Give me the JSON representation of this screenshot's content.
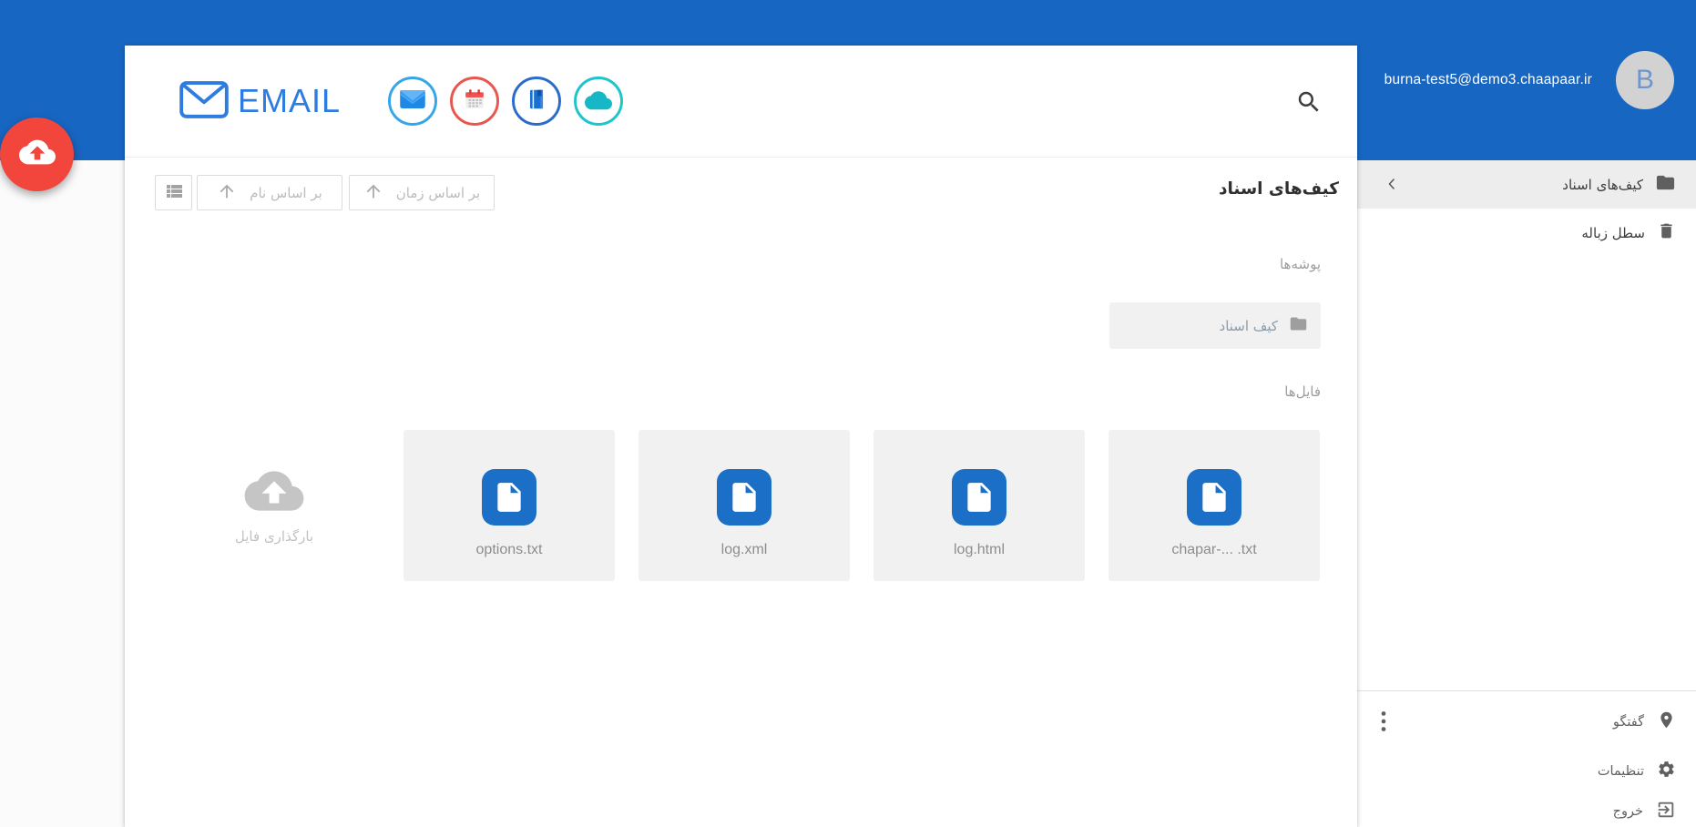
{
  "topbar": {
    "email": "burna-test5@demo3.chaapaar.ir",
    "avatar_letter": "B"
  },
  "brand": {
    "logo_text": "EMAIL"
  },
  "app_icons": [
    {
      "name": "mail",
      "ring_color": "#35a7e9"
    },
    {
      "name": "calendar",
      "ring_color": "#e8564e"
    },
    {
      "name": "contacts-book",
      "ring_color": "#2a6cc9"
    },
    {
      "name": "cloud-storage",
      "ring_color": "#1fc4cd"
    }
  ],
  "toolbar": {
    "sort_by_name": "بر اساس نام",
    "sort_by_time": "بر اساس زمان"
  },
  "content": {
    "title": "کیف‌های اسناد",
    "folders_label": "پوشه‌ها",
    "files_label": "فایل‌ها",
    "folders": [
      {
        "name": "کیف اسناد"
      }
    ],
    "files": [
      {
        "name": "options.txt"
      },
      {
        "name": "log.xml"
      },
      {
        "name": "log.html"
      },
      {
        "name": "chapar-... .txt"
      }
    ],
    "upload_label": "بارگذاری فایل"
  },
  "sidebar": {
    "items": [
      {
        "label": "کیف‌های اسناد",
        "selected": true
      },
      {
        "label": "سطل زباله",
        "selected": false
      }
    ],
    "footer_items": [
      {
        "label": "گفتگو"
      },
      {
        "label": "تنظیمات"
      },
      {
        "label": "خروج"
      }
    ]
  },
  "colors": {
    "topbar_blue": "#1766c2",
    "fab_red": "#f2463c",
    "logo_blue": "#2e7cdf",
    "file_icon_blue": "#1b6fc7",
    "card_gray": "#f1f1f1",
    "selected_item_gray": "#ededed"
  }
}
